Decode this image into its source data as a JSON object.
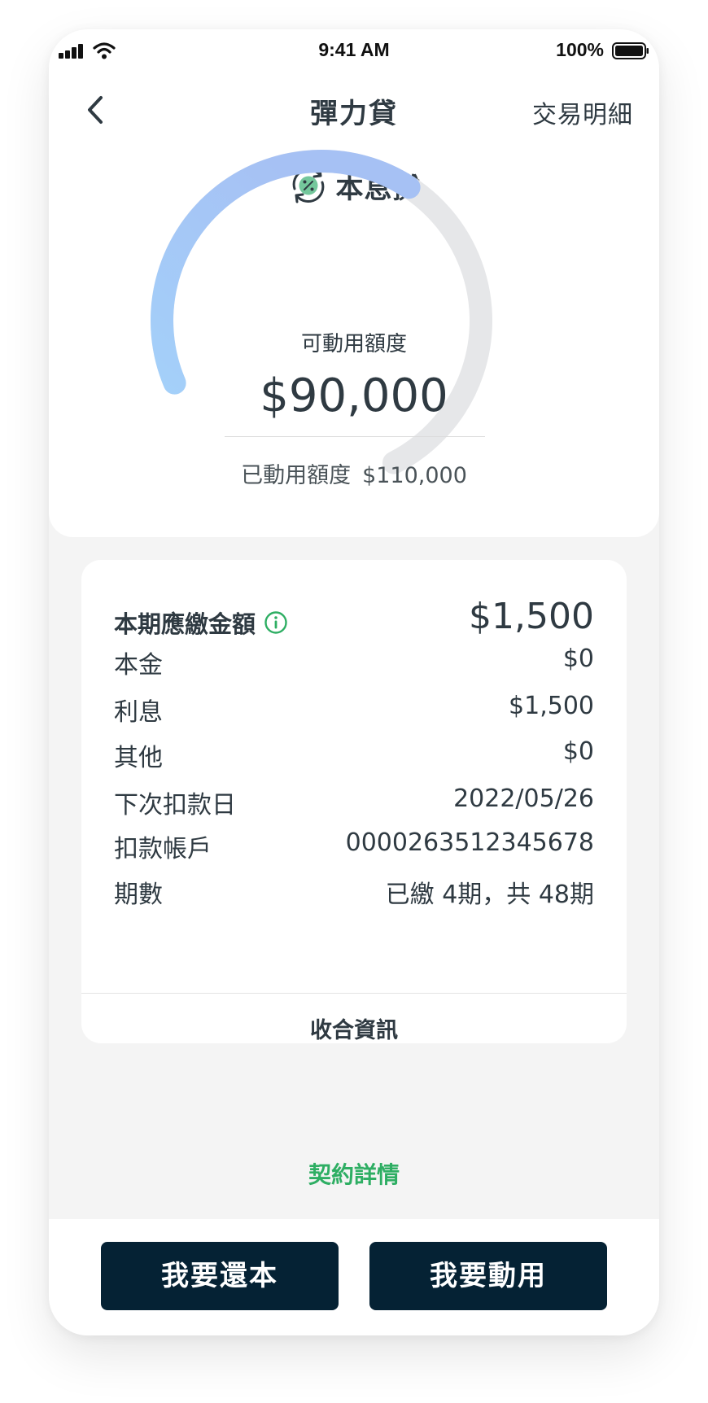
{
  "status_bar": {
    "time": "9:41 AM",
    "battery": "100%"
  },
  "nav": {
    "title": "彈力貸",
    "right_link": "交易明細"
  },
  "product": {
    "name": "本息攤"
  },
  "gauge": {
    "label": "可動用額度",
    "available": "$90,000",
    "used_label": "已動用額度",
    "used": "$110,000",
    "used_fraction": 0.55,
    "colors": {
      "track": "#e6e7e9",
      "start": "#a3d4fb",
      "end": "#a6c1f4"
    }
  },
  "payment": {
    "due_label": "本期應繳金額",
    "due_amount": "$1,500",
    "rows": [
      {
        "label": "本金",
        "value": "$0"
      },
      {
        "label": "利息",
        "value": "$1,500"
      },
      {
        "label": "其他",
        "value": "$0"
      },
      {
        "label": "下次扣款日",
        "value": "2022/05/26"
      },
      {
        "label": "扣款帳戶",
        "value": "0000263512345678"
      },
      {
        "label": "期數",
        "value": "已繳 4期，共 48期"
      }
    ],
    "collapse_label": "收合資訊"
  },
  "contract_link": "契約詳情",
  "actions": {
    "repay": "我要還本",
    "draw": "我要動用"
  },
  "icons": {
    "back": "chevron-left-icon",
    "product": "percent-cycle-icon",
    "info": "info-icon"
  },
  "theme": {
    "accent_green": "#2eae63",
    "button_dark": "#052234"
  }
}
